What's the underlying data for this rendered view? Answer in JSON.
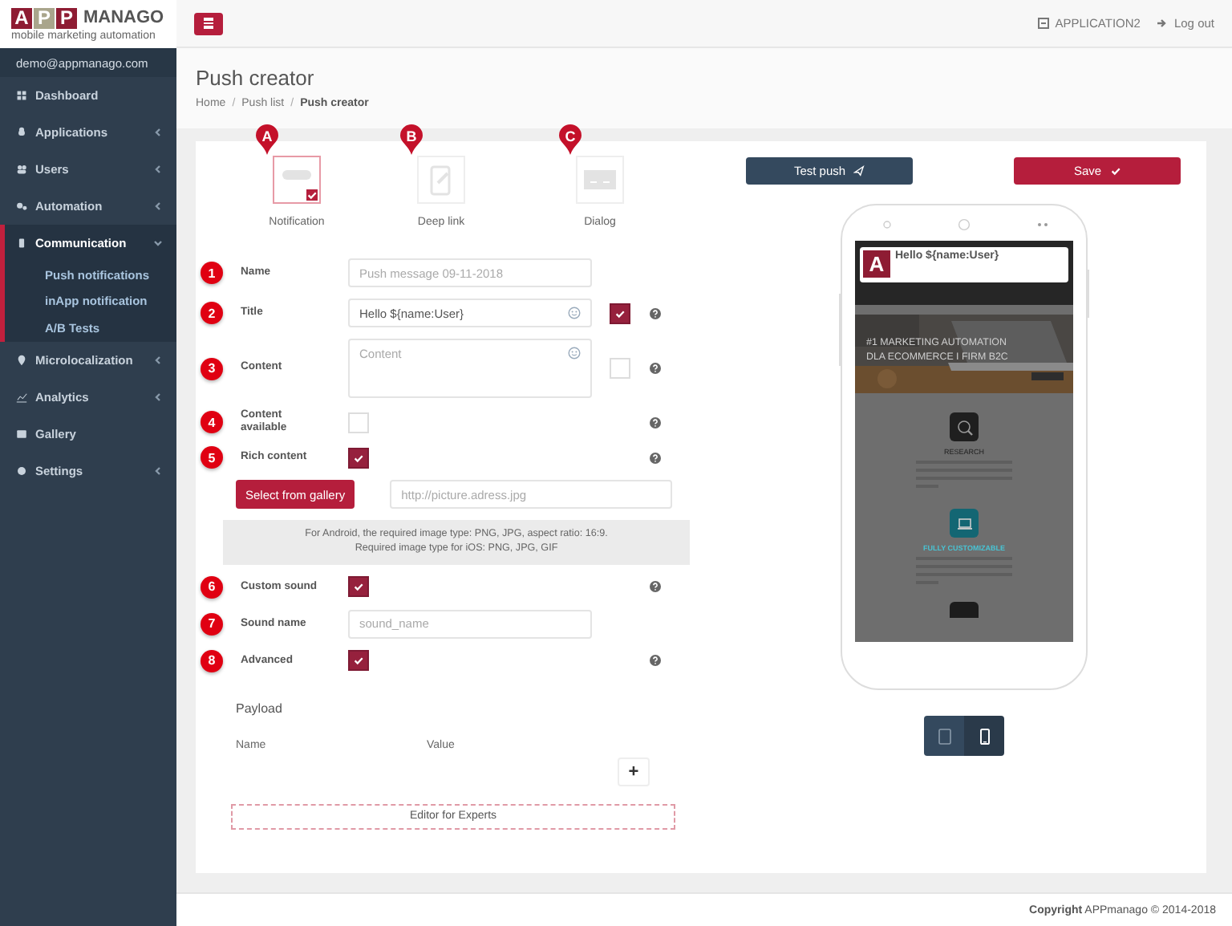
{
  "sidebar": {
    "logo": {
      "letters": [
        "A",
        "P",
        "P"
      ],
      "name": "MANAGO",
      "tagline": "mobile marketing automation"
    },
    "user": "demo@appmanago.com",
    "items": [
      {
        "label": "Dashboard",
        "selected": false,
        "has_submenu": false
      },
      {
        "label": "Applications",
        "selected": false,
        "has_submenu": true,
        "expanded": false
      },
      {
        "label": "Users",
        "selected": false,
        "has_submenu": true,
        "expanded": false
      },
      {
        "label": "Automation",
        "selected": false,
        "has_submenu": true,
        "expanded": false
      },
      {
        "label": "Communication",
        "selected": true,
        "has_submenu": true,
        "expanded": true,
        "children": [
          "Push notifications",
          "inApp notification",
          "A/B Tests"
        ]
      },
      {
        "label": "Microlocalization",
        "selected": false,
        "has_submenu": true,
        "expanded": false
      },
      {
        "label": "Analytics",
        "selected": false,
        "has_submenu": true,
        "expanded": false
      },
      {
        "label": "Gallery",
        "selected": false,
        "has_submenu": false
      },
      {
        "label": "Settings",
        "selected": false,
        "has_submenu": true,
        "expanded": false
      }
    ]
  },
  "topbar": {
    "application": "APPLICATION2",
    "logout": "Log out"
  },
  "header": {
    "title": "Push creator",
    "separator": "/",
    "breadcrumb": [
      {
        "label": "Home",
        "current": false
      },
      {
        "label": "Push list",
        "current": false
      },
      {
        "label": "Push creator",
        "current": true
      }
    ]
  },
  "types": [
    {
      "marker": "A",
      "label": "Notification",
      "kind": "notification",
      "selected": true
    },
    {
      "marker": "B",
      "label": "Deep link",
      "kind": "deeplink",
      "selected": false
    },
    {
      "marker": "C",
      "label": "Dialog",
      "kind": "dialog",
      "selected": false
    }
  ],
  "fields": [
    {
      "number": "1",
      "label": "Name",
      "kind": "text",
      "placeholder": "Push message 09-11-2018",
      "help": false
    },
    {
      "number": "2",
      "label": "Title",
      "kind": "text",
      "value": "Hello ${name:User}",
      "emoji": true,
      "option_checked": true,
      "help": true
    },
    {
      "number": "3",
      "label": "Content",
      "kind": "textarea",
      "placeholder": "Content",
      "emoji": true,
      "option_checked": false,
      "help": true
    },
    {
      "number": "4",
      "label": "Content available",
      "kind": "checkbox",
      "checked": false,
      "help": true
    },
    {
      "number": "5",
      "label": "Rich content",
      "kind": "checkbox",
      "checked": true,
      "help": true
    },
    {
      "kind": "media",
      "button": "Select from gallery",
      "placeholder": "http://picture.adress.jpg",
      "info": [
        "For Android, the required image type: PNG, JPG, aspect ratio: 16:9.",
        "Required image type for iOS: PNG, JPG, GIF"
      ]
    },
    {
      "number": "6",
      "label": "Custom sound",
      "kind": "checkbox",
      "checked": true,
      "help": true
    },
    {
      "number": "7",
      "label": "Sound name",
      "kind": "text",
      "placeholder": "sound_name",
      "help": false
    },
    {
      "number": "8",
      "label": "Advanced",
      "kind": "checkbox",
      "checked": true,
      "help": true
    }
  ],
  "payload": {
    "title": "Payload",
    "columns": [
      "Name",
      "Value"
    ],
    "add": "+",
    "editor": "Editor for Experts"
  },
  "preview": {
    "test_button": "Test push",
    "save_button": "Save",
    "notification": {
      "logo": "A",
      "title": "Hello ${name:User}"
    },
    "site": {
      "hero": [
        "#1 MARKETING AUTOMATION",
        "DLA ECOMMERCE I FIRM B2C"
      ],
      "features": [
        {
          "label": "RESEARCH",
          "kind": "research"
        },
        {
          "label": "FULLY CUSTOMIZABLE",
          "kind": "custom"
        }
      ]
    },
    "devices": [
      {
        "kind": "tablet",
        "selected": false
      },
      {
        "kind": "phone",
        "selected": true
      }
    ]
  },
  "footer": "**Copyright** APPmanago © 2014-2018"
}
